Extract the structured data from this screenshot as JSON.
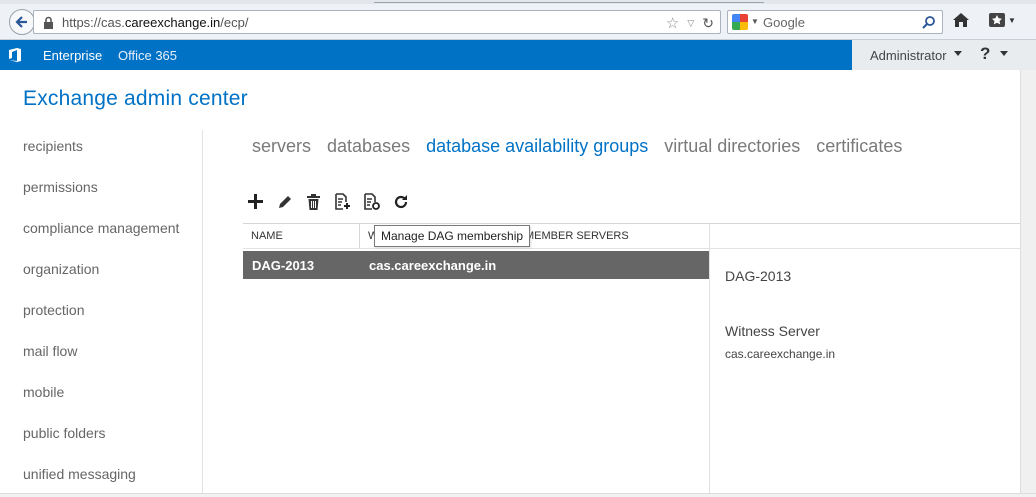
{
  "browser": {
    "url_prefix": "https://cas.",
    "url_domain": "careexchange.in",
    "url_path": "/ecp/",
    "search_placeholder": "Google"
  },
  "topbar": {
    "nav_items": [
      "Enterprise",
      "Office 365"
    ],
    "user": "Administrator",
    "help": "?"
  },
  "app": {
    "title": "Exchange admin center"
  },
  "left_nav": [
    "recipients",
    "permissions",
    "compliance management",
    "organization",
    "protection",
    "mail flow",
    "mobile",
    "public folders",
    "unified messaging"
  ],
  "tabs": [
    {
      "label": "servers",
      "active": false
    },
    {
      "label": "databases",
      "active": false
    },
    {
      "label": "database availability groups",
      "active": true
    },
    {
      "label": "virtual directories",
      "active": false
    },
    {
      "label": "certificates",
      "active": false
    }
  ],
  "toolbar": [
    "add-icon",
    "edit-icon",
    "delete-icon",
    "manage-dag-membership-icon",
    "manage-dag-network-icon",
    "refresh-icon"
  ],
  "grid": {
    "columns": [
      "NAME",
      "W",
      "MEMBER SERVERS"
    ],
    "rows": [
      {
        "name": "DAG-2013",
        "member_servers": "cas.careexchange.in"
      }
    ]
  },
  "tooltip": "Manage DAG membership",
  "details": {
    "title": "DAG-2013",
    "witness_label": "Witness Server",
    "witness_value": "cas.careexchange.in"
  },
  "colors": {
    "brand_blue": "#0072c6",
    "selected_row": "#666666"
  }
}
